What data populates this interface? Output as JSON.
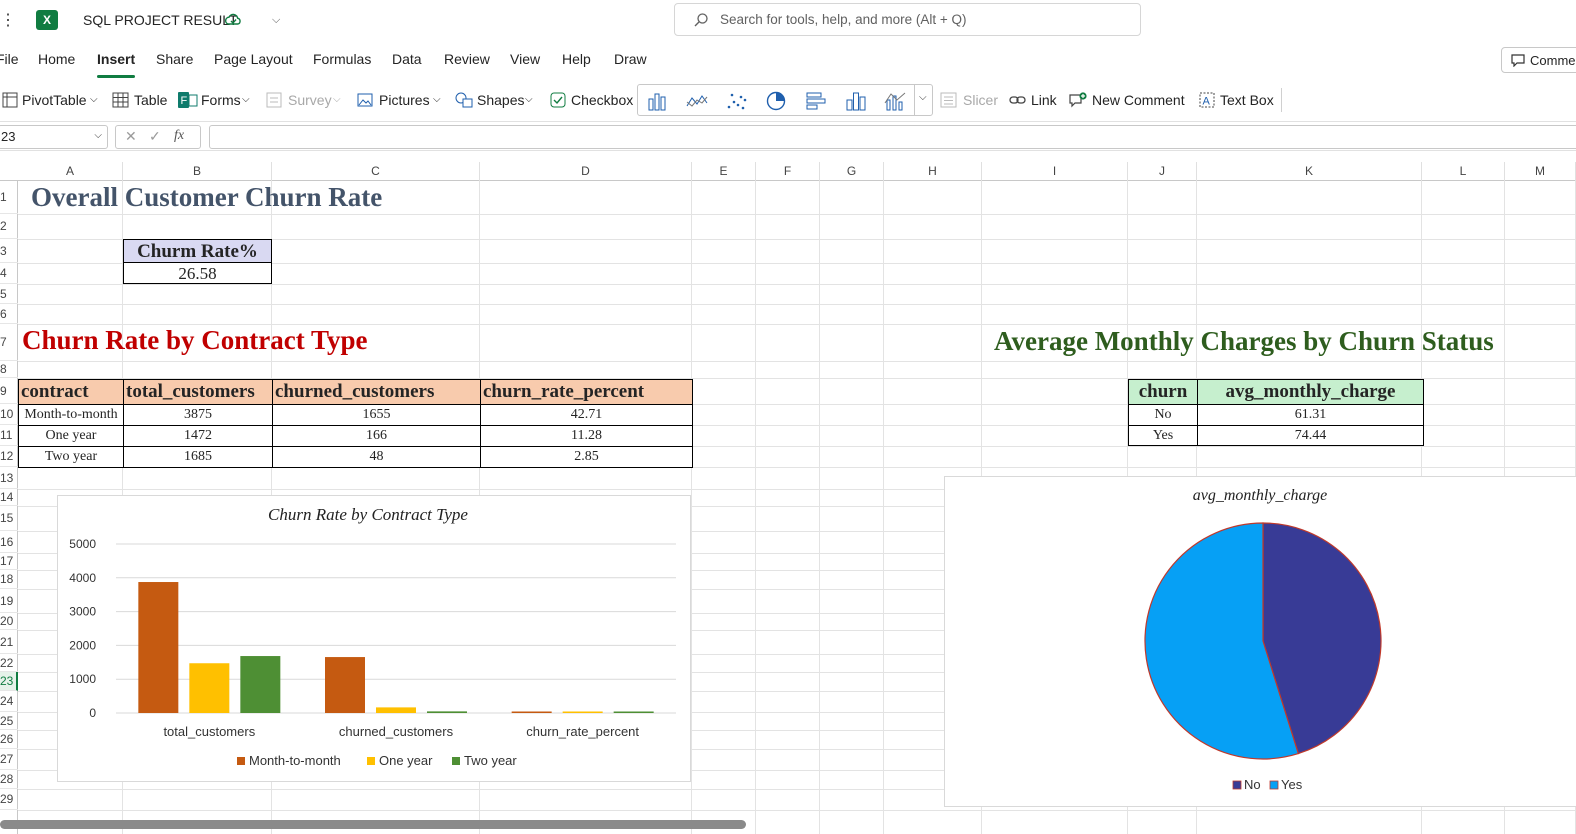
{
  "app": {
    "title": "SQL PROJECT RESULT",
    "search_placeholder": "Search for tools, help, and more (Alt + Q)",
    "comments_label": "Comme",
    "accent": "#107c41"
  },
  "menu": [
    "File",
    "Home",
    "Insert",
    "Share",
    "Page Layout",
    "Formulas",
    "Data",
    "Review",
    "View",
    "Help",
    "Draw"
  ],
  "active_menu": "Insert",
  "ribbon": {
    "pivottable": "PivotTable",
    "table": "Table",
    "forms": "Forms",
    "survey": "Survey",
    "pictures": "Pictures",
    "shapes": "Shapes",
    "checkbox": "Checkbox",
    "slicer": "Slicer",
    "link": "Link",
    "new_comment": "New Comment",
    "text_box": "Text Box"
  },
  "formula_bar": {
    "name_box": "23",
    "fx": "fx",
    "formula": ""
  },
  "columns": [
    "A",
    "B",
    "C",
    "D",
    "E",
    "F",
    "G",
    "H",
    "I",
    "J",
    "K",
    "L",
    "M"
  ],
  "rows": [
    "1",
    "2",
    "3",
    "4",
    "5",
    "6",
    "7",
    "8",
    "9",
    "10",
    "11",
    "12",
    "13",
    "14",
    "15",
    "16",
    "17",
    "18",
    "19",
    "20",
    "21",
    "22",
    "23",
    "24",
    "25",
    "26",
    "27",
    "28",
    "29"
  ],
  "sheet": {
    "title_overall": "Overall Customer Churn Rate",
    "churn_header": "Churm Rate%",
    "churn_value": "26.58",
    "title_contract": "Churn Rate by Contract Type",
    "title_monthly": "Average Monthly Charges by Churn Status",
    "contract_table": {
      "headers": [
        "contract",
        "total_customers",
        "churned_customers",
        "churn_rate_percent"
      ],
      "rows": [
        [
          "Month-to-month",
          "3875",
          "1655",
          "42.71"
        ],
        [
          "One year",
          "1472",
          "166",
          "11.28"
        ],
        [
          "Two year",
          "1685",
          "48",
          "2.85"
        ]
      ]
    },
    "charge_table": {
      "headers": [
        "churn",
        "avg_monthly_charge"
      ],
      "rows": [
        [
          "No",
          "61.31"
        ],
        [
          "Yes",
          "74.44"
        ]
      ]
    }
  },
  "chart_data": [
    {
      "type": "bar",
      "title": "Churn Rate by Contract Type",
      "categories": [
        "total_customers",
        "churned_customers",
        "churn_rate_percent"
      ],
      "series": [
        {
          "name": "Month-to-month",
          "values": [
            3875,
            1655,
            42.71
          ],
          "color": "#c55a11"
        },
        {
          "name": "One year",
          "values": [
            1472,
            166,
            11.28
          ],
          "color": "#ffc000"
        },
        {
          "name": "Two year",
          "values": [
            1685,
            48,
            2.85
          ],
          "color": "#4e8f34"
        }
      ],
      "yticks": [
        "0",
        "1000",
        "2000",
        "3000",
        "4000",
        "5000"
      ],
      "ylim": [
        0,
        5000
      ],
      "grid": true,
      "legend": "bottom"
    },
    {
      "type": "pie",
      "title": "avg_monthly_charge",
      "categories": [
        "No",
        "Yes"
      ],
      "values": [
        61.31,
        74.44
      ],
      "colors": [
        "#383b96",
        "#06a0f5"
      ],
      "legend": "bottom"
    }
  ]
}
